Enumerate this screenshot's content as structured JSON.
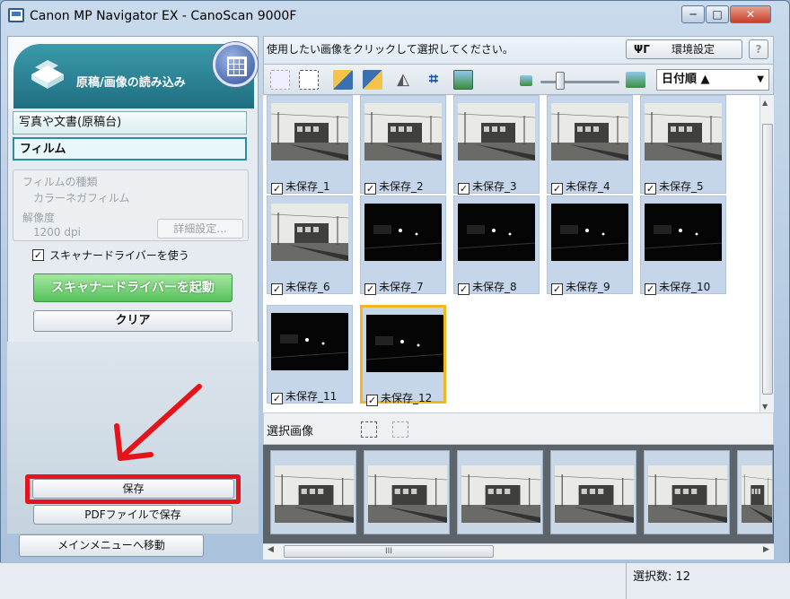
{
  "window": {
    "title": "Canon MP Navigator EX - CanoScan 9000F",
    "min": "─",
    "max": "□",
    "close": "✕"
  },
  "left_panel": {
    "header_label": "原稿/画像の読み込み",
    "source_options": [
      "写真や文書(原稿台)",
      "フィルム"
    ],
    "film_type_label": "フィルムの種類",
    "film_type_value": "カラーネガフィルム",
    "resolution_label": "解像度",
    "resolution_value": "1200 dpi",
    "detail_button": "詳細設定...",
    "use_driver_label": "スキャナードライバーを使う",
    "use_driver_checked": true,
    "launch_driver_button": "スキャナードライバーを起動",
    "clear_button": "クリア",
    "save_button": "保存",
    "save_pdf_button": "PDFファイルで保存",
    "main_menu_button": "メインメニューへ移動"
  },
  "main": {
    "instruction": "使用したい画像をクリックして選択してください。",
    "settings_button": "環境設定",
    "help_button": "?",
    "sort_value": "日付順 ▲",
    "zoom_level": 0.25,
    "thumbnails": [
      {
        "label": "未保存_1",
        "scene": "day"
      },
      {
        "label": "未保存_2",
        "scene": "day"
      },
      {
        "label": "未保存_3",
        "scene": "day"
      },
      {
        "label": "未保存_4",
        "scene": "day"
      },
      {
        "label": "未保存_5",
        "scene": "day"
      },
      {
        "label": "未保存_6",
        "scene": "day"
      },
      {
        "label": "未保存_7",
        "scene": "night"
      },
      {
        "label": "未保存_8",
        "scene": "night"
      },
      {
        "label": "未保存_9",
        "scene": "night"
      },
      {
        "label": "未保存_10",
        "scene": "night"
      },
      {
        "label": "未保存_11",
        "scene": "night"
      },
      {
        "label": "未保存_12",
        "scene": "night"
      }
    ],
    "selected_section_label": "選択画像",
    "status_selected": "選択数: 12"
  },
  "colors": {
    "accent_red": "#e5141a",
    "selected_border": "#f0b820",
    "header_teal": "#1f6f82",
    "launch_green": "#55c25a"
  }
}
